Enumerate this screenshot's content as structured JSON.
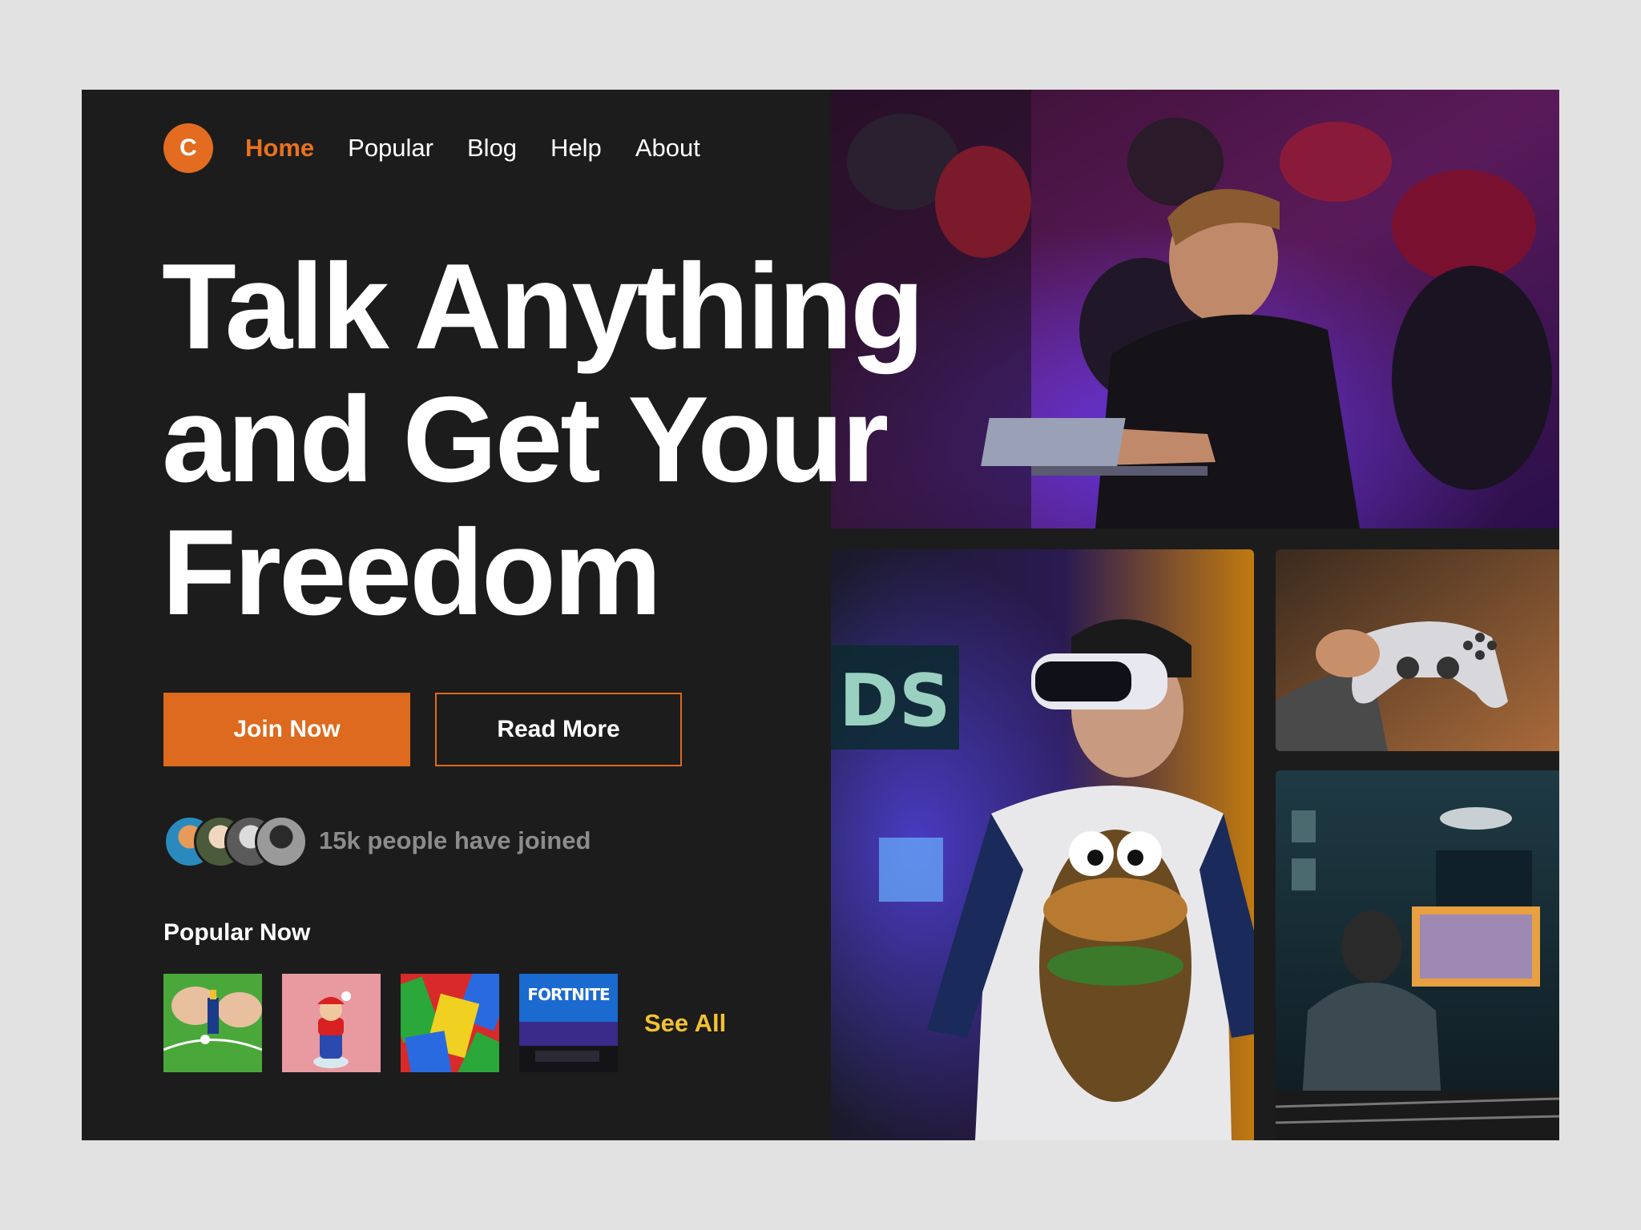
{
  "brand": {
    "logo_letter": "C",
    "accent": "#e36c20"
  },
  "nav": {
    "items": [
      {
        "label": "Home",
        "active": true
      },
      {
        "label": "Popular",
        "active": false
      },
      {
        "label": "Blog",
        "active": false
      },
      {
        "label": "Help",
        "active": false
      },
      {
        "label": "About",
        "active": false
      }
    ]
  },
  "hero": {
    "title_lines": [
      "Talk Anything",
      "and Get Your",
      "Freedom"
    ],
    "join_label": "Join Now",
    "read_label": "Read More"
  },
  "community": {
    "joined_text": "15k people have joined",
    "avatar_count": 4
  },
  "popular": {
    "heading": "Popular Now",
    "see_all_label": "See All",
    "thumbnails": [
      {
        "name": "foosball-figure"
      },
      {
        "name": "mario-figure"
      },
      {
        "name": "uno-cards"
      },
      {
        "name": "fortnite-setup",
        "caption": "FORTNITE"
      }
    ]
  },
  "images": [
    {
      "name": "hacker-laptop-photo"
    },
    {
      "name": "vr-headset-photo"
    },
    {
      "name": "game-controller-photo"
    },
    {
      "name": "console-gaming-room-photo"
    }
  ]
}
